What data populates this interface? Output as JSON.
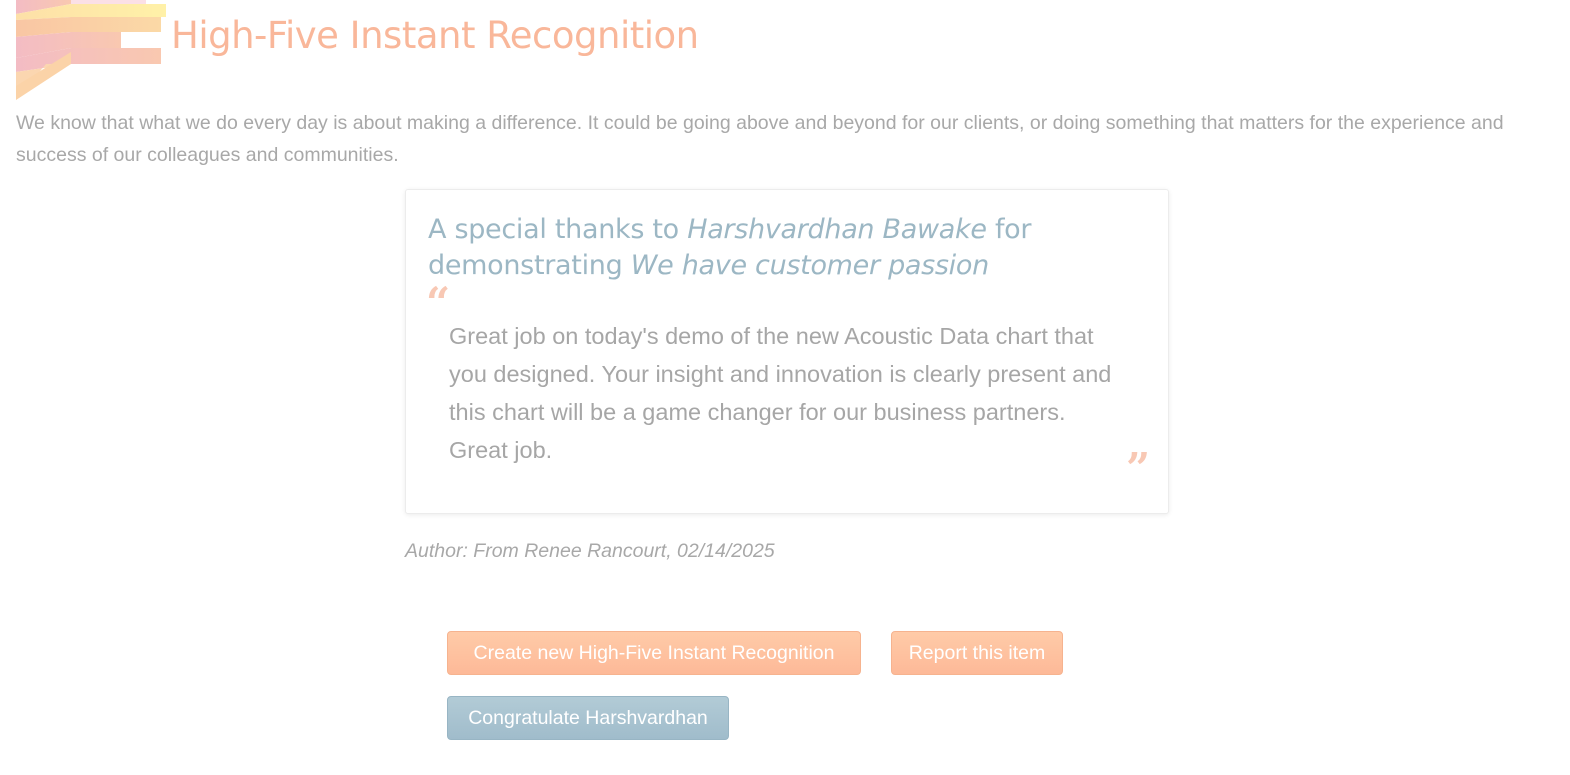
{
  "header": {
    "title": "High-Five Instant Recognition"
  },
  "intro": {
    "text": "We know that what we do every day is about making a difference. It could be going above and beyond for our clients, or doing something that matters for the experience and success of our colleagues and communities."
  },
  "card": {
    "heading_prefix": "A special thanks to ",
    "recipient": "Harshvardhan Bawake",
    "heading_mid": " for demonstrating ",
    "value": "We have customer passion",
    "quote_open": "“",
    "quote_close": "”",
    "message": "Great job on today's demo of the new Acoustic Data chart that you designed. Your insight and innovation is clearly present and this chart will be a game changer for our business partners. Great job."
  },
  "author": {
    "text": "Author: From Renee Rancourt, 02/14/2025"
  },
  "buttons": {
    "create": "Create new High-Five Instant Recognition",
    "report": "Report this item",
    "congratulate": "Congratulate Harshvardhan"
  },
  "colors": {
    "title": "#f9b79a",
    "heading": "#9cb7c4",
    "body_text": "#a8a8a8",
    "orange_button": "#fdb998",
    "blue_button": "#a0bccb"
  },
  "icons": {
    "logo": "high-five-logo-icon"
  }
}
